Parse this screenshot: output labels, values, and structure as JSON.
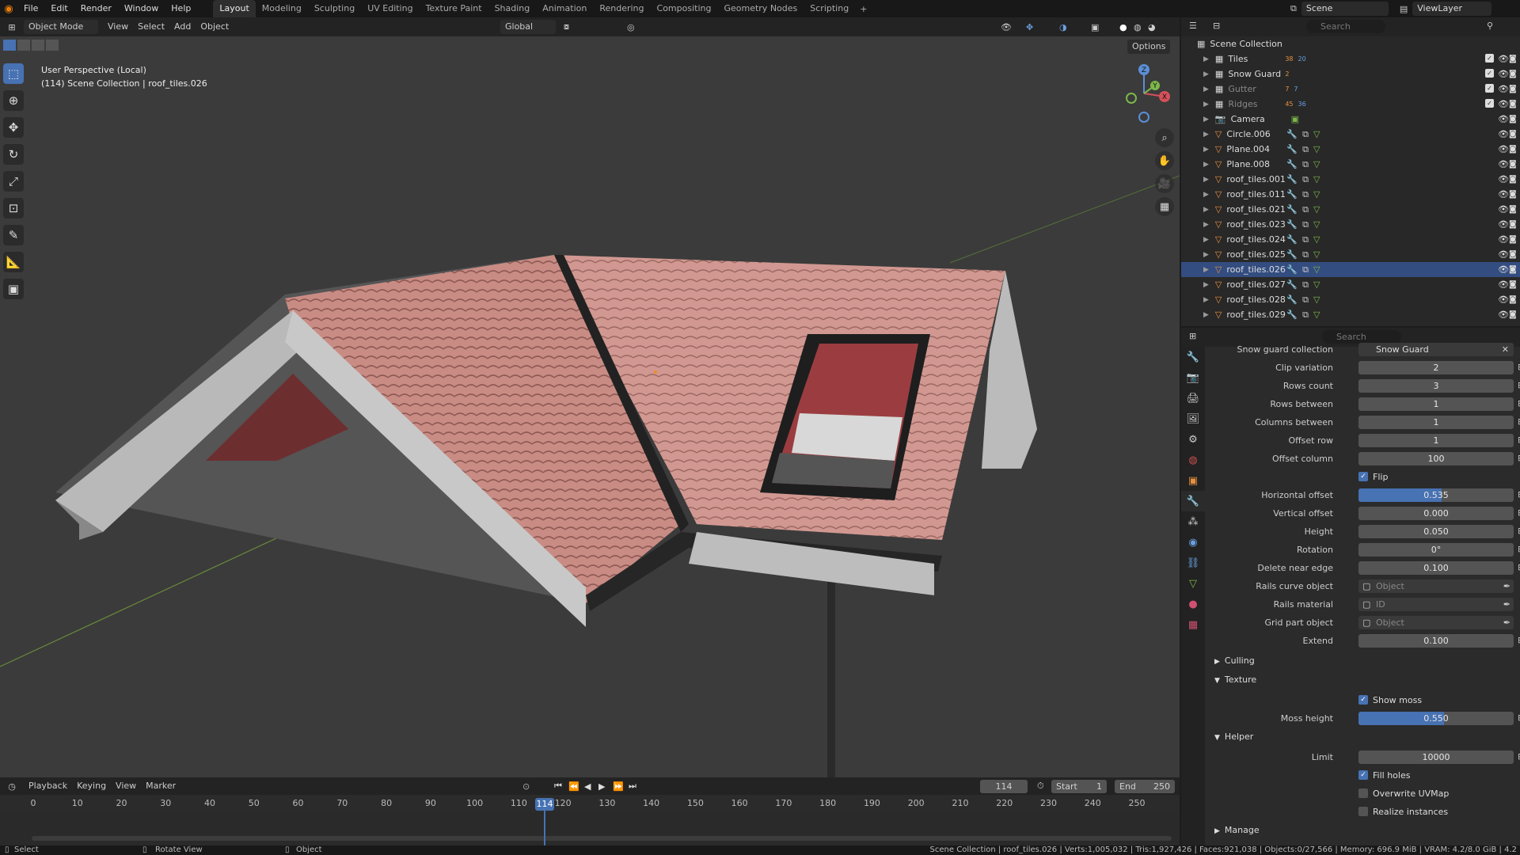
{
  "menu": [
    "File",
    "Edit",
    "Render",
    "Window",
    "Help"
  ],
  "workspaces": [
    "Layout",
    "Modeling",
    "Sculpting",
    "UV Editing",
    "Texture Paint",
    "Shading",
    "Animation",
    "Rendering",
    "Compositing",
    "Geometry Nodes",
    "Scripting"
  ],
  "active_workspace": "Layout",
  "scene_name": "Scene",
  "view_layer": "ViewLayer",
  "viewport": {
    "mode": "Object Mode",
    "menus": [
      "View",
      "Select",
      "Add",
      "Object"
    ],
    "transform_orientation": "Global",
    "options_label": "Options",
    "overlay_line1": "User Perspective (Local)",
    "overlay_line2": "(114) Scene Collection | roof_tiles.026",
    "gizmo": {
      "x": "X",
      "y": "Y",
      "z": "Z"
    }
  },
  "timeline": {
    "menus": [
      "Playback",
      "Keying",
      "View",
      "Marker"
    ],
    "current_frame": "114",
    "start_label": "Start",
    "start": "1",
    "end_label": "End",
    "end": "250",
    "ticks": [
      "0",
      "10",
      "20",
      "30",
      "40",
      "50",
      "60",
      "70",
      "80",
      "90",
      "100",
      "110",
      "120",
      "130",
      "140",
      "150",
      "160",
      "170",
      "180",
      "190",
      "200",
      "210",
      "220",
      "230",
      "240",
      "250"
    ]
  },
  "outliner": {
    "search_placeholder": "Search",
    "root": "Scene Collection",
    "rows": [
      {
        "name": "Tiles",
        "badge": "38",
        "badge2": "20"
      },
      {
        "name": "Snow Guard",
        "badge": "2",
        "badge2": ""
      },
      {
        "name": "Gutter",
        "badge": "7",
        "badge2": "7"
      },
      {
        "name": "Ridges",
        "badge": "45",
        "badge2": "36"
      },
      {
        "name": "Camera",
        "badge": "",
        "badge2": ""
      },
      {
        "name": "Circle.006",
        "badge": "",
        "badge2": ""
      },
      {
        "name": "Plane.004",
        "badge": "",
        "badge2": ""
      },
      {
        "name": "Plane.008",
        "badge": "",
        "badge2": ""
      },
      {
        "name": "roof_tiles.001",
        "badge": "",
        "badge2": ""
      },
      {
        "name": "roof_tiles.011",
        "badge": "",
        "badge2": ""
      },
      {
        "name": "roof_tiles.021",
        "badge": "",
        "badge2": ""
      },
      {
        "name": "roof_tiles.023",
        "badge": "",
        "badge2": ""
      },
      {
        "name": "roof_tiles.024",
        "badge": "",
        "badge2": ""
      },
      {
        "name": "roof_tiles.025",
        "badge": "",
        "badge2": ""
      },
      {
        "name": "roof_tiles.026",
        "badge": "",
        "badge2": ""
      },
      {
        "name": "roof_tiles.027",
        "badge": "",
        "badge2": ""
      },
      {
        "name": "roof_tiles.028",
        "badge": "",
        "badge2": ""
      },
      {
        "name": "roof_tiles.029",
        "badge": "",
        "badge2": ""
      }
    ]
  },
  "properties": {
    "search_placeholder": "Search",
    "snow_guard_label": "Snow guard collection",
    "snow_guard_value": "Snow Guard",
    "fields": [
      {
        "label": "Clip variation",
        "value": "2"
      },
      {
        "label": "Rows count",
        "value": "3"
      },
      {
        "label": "Rows between",
        "value": "1"
      },
      {
        "label": "Columns between",
        "value": "1"
      },
      {
        "label": "Offset row",
        "value": "1"
      },
      {
        "label": "Offset column",
        "value": "100"
      }
    ],
    "flip_label": "Flip",
    "fields2": [
      {
        "label": "Horizontal offset",
        "value": "0.535",
        "fill": 0.535
      },
      {
        "label": "Vertical offset",
        "value": "0.000",
        "fill": 0
      },
      {
        "label": "Height",
        "value": "0.050",
        "fill": 0
      },
      {
        "label": "Rotation",
        "value": "0°",
        "fill": 0
      },
      {
        "label": "Delete near edge",
        "value": "0.100",
        "fill": 0
      }
    ],
    "rails_curve_label": "Rails curve object",
    "rails_curve_placeholder": "Object",
    "rails_material_label": "Rails material",
    "rails_material_placeholder": "ID",
    "grid_part_label": "Grid part object",
    "grid_part_placeholder": "Object",
    "extend_label": "Extend",
    "extend_value": "0.100",
    "culling_label": "Culling",
    "texture_label": "Texture",
    "show_moss_label": "Show moss",
    "moss_height_label": "Moss height",
    "moss_height_value": "0.550",
    "moss_height_fill": 0.55,
    "helper_label": "Helper",
    "limit_label": "Limit",
    "limit_value": "10000",
    "fill_holes_label": "Fill holes",
    "overwrite_uv_label": "Overwrite UVMap",
    "realize_label": "Realize instances",
    "manage_label": "Manage"
  },
  "status": {
    "select": "Select",
    "rotate": "Rotate View",
    "object": "Object",
    "info": "Scene Collection | roof_tiles.026 | Verts:1,005,032 | Tris:1,927,426 | Faces:921,038 | Objects:0/27,566 | Memory: 696.9 MiB | VRAM: 4.2/8.0 GiB | 4.2"
  },
  "colors": {
    "accent": "#4772b3",
    "roof": "#c98c84",
    "header": "#232323"
  }
}
